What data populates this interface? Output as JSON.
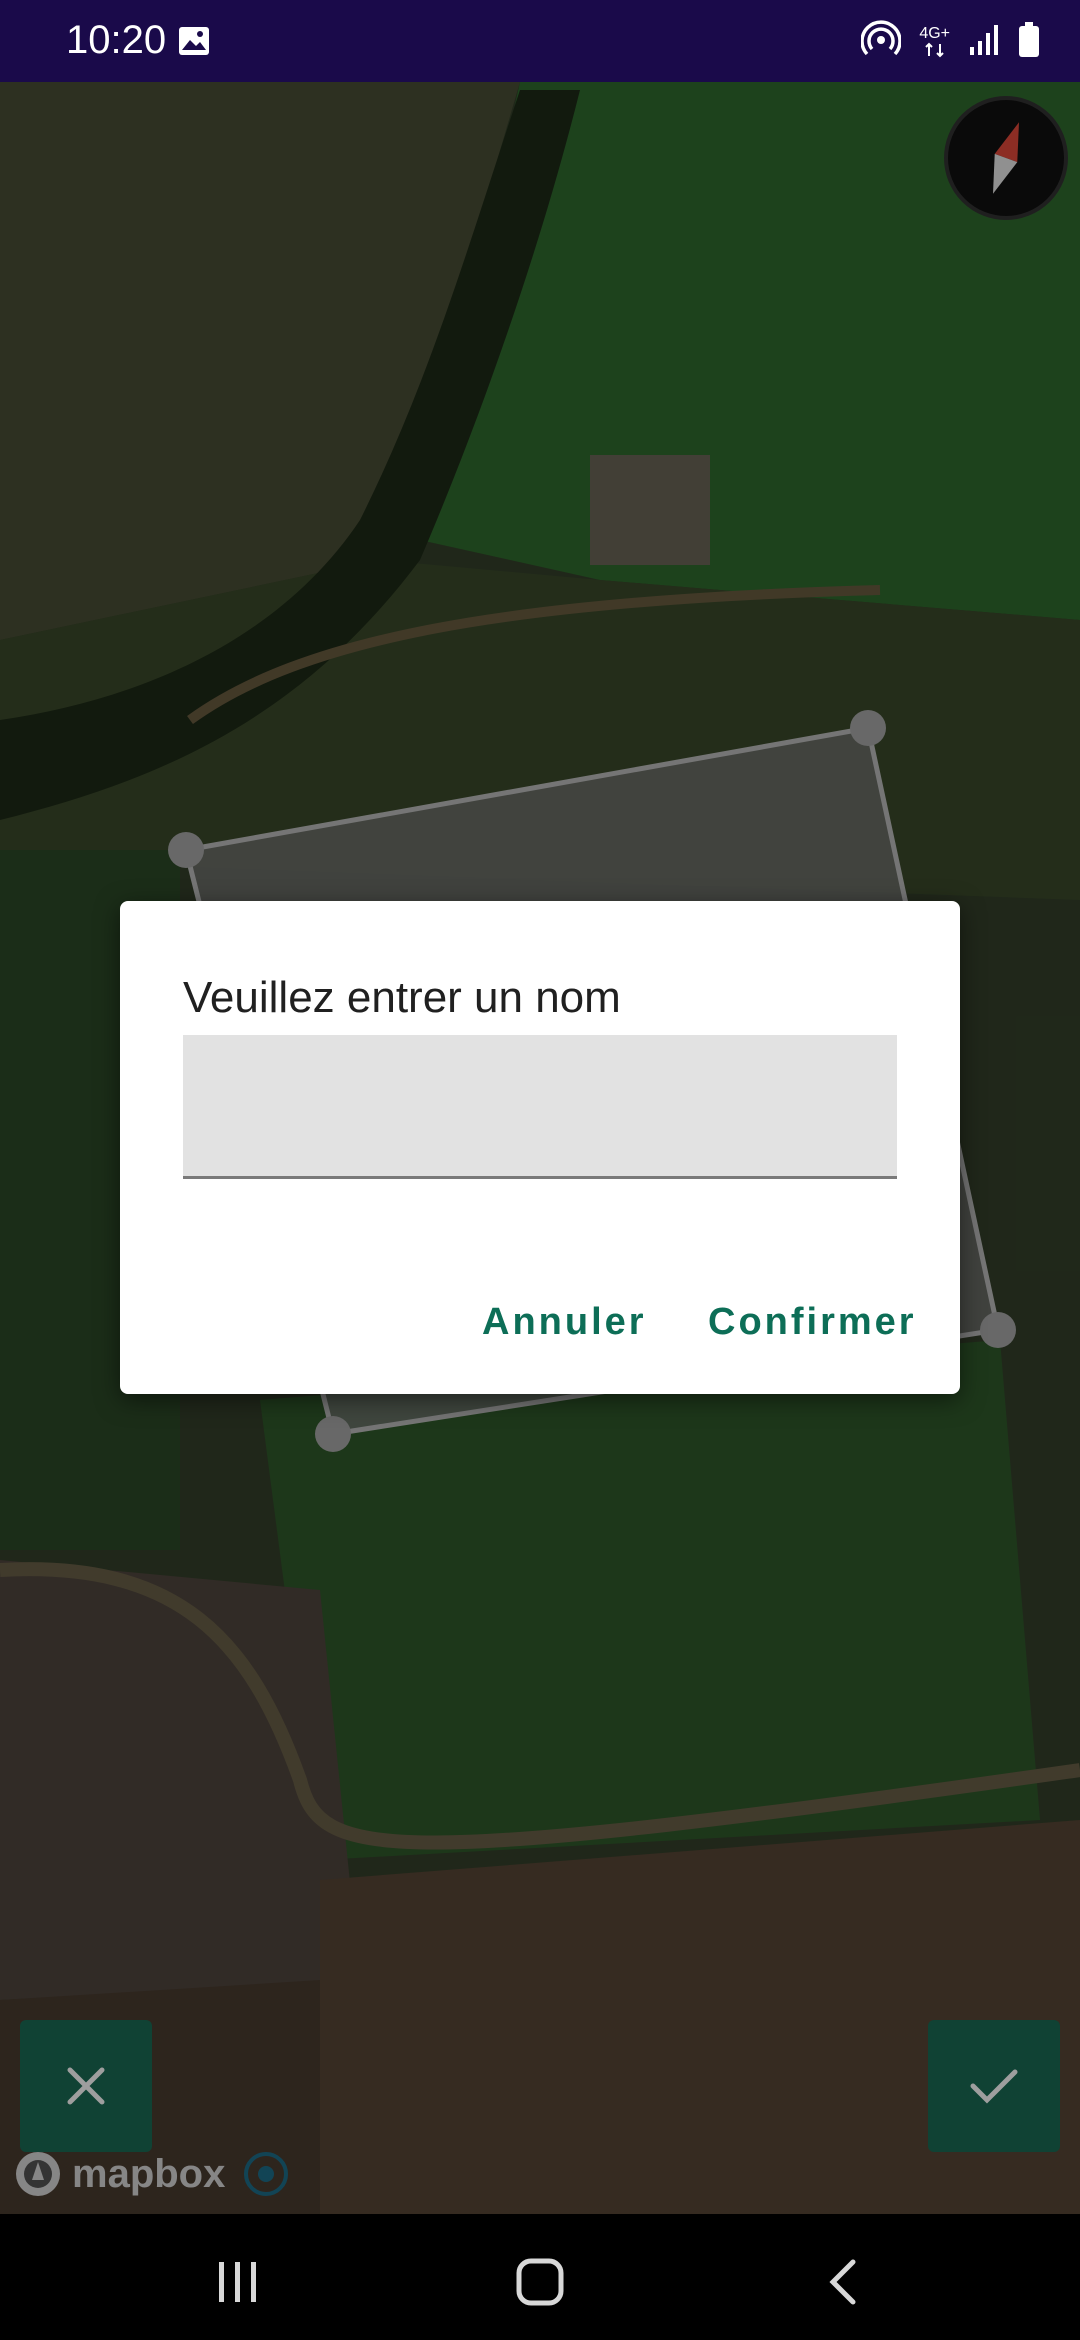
{
  "status_bar": {
    "time": "10:20",
    "network": "4G+",
    "icons": [
      "image-icon",
      "hotspot-icon",
      "signal-icon",
      "battery-icon"
    ]
  },
  "map": {
    "attribution": "mapbox",
    "icons": [
      "compass-icon",
      "close-icon",
      "check-icon",
      "info-icon"
    ]
  },
  "dialog": {
    "title": "Veuillez entrer un nom",
    "input_value": "",
    "cancel_label": "Annuler",
    "confirm_label": "Confirmer"
  },
  "nav_bar": {
    "icons": [
      "recents-icon",
      "home-icon",
      "back-icon"
    ]
  },
  "colors": {
    "status_bar": "#1a0a4a",
    "accent": "#0d6e57",
    "map_button": "#1b6b55"
  }
}
